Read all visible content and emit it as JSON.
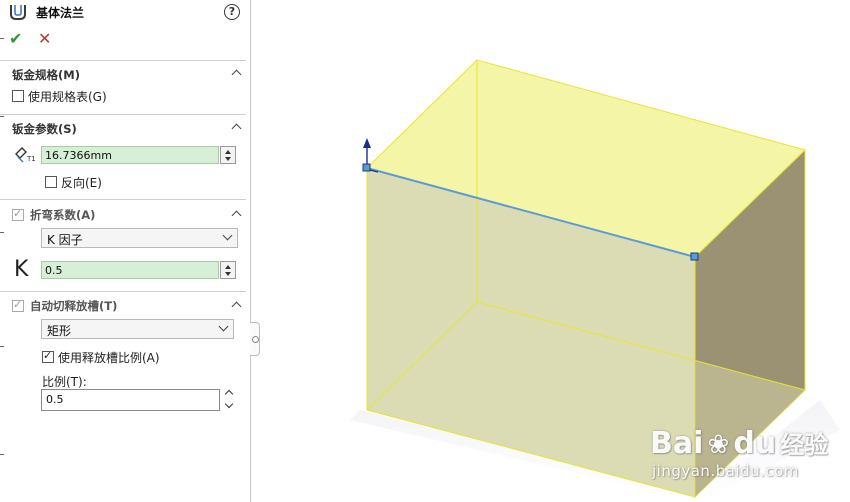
{
  "panel": {
    "title": "基体法兰",
    "help_icon": "help-circle-icon",
    "ok_icon": "checkmark-icon",
    "cancel_icon": "close-icon"
  },
  "sections": {
    "gauge": {
      "title": "钣金规格(M)",
      "use_gauge_table_label": "使用规格表(G)",
      "use_gauge_table_checked": false
    },
    "params": {
      "title": "钣金参数(S)",
      "thickness_value": "16.7366mm",
      "reverse_label": "反向(E)",
      "reverse_checked": false
    },
    "bend_allowance": {
      "title": "折弯系数(A)",
      "type_value": "K 因子",
      "k_value": "0.5",
      "enabled": true
    },
    "auto_relief": {
      "title": "自动切释放槽(T)",
      "type_value": "矩形",
      "use_ratio_label": "使用释放槽比例(A)",
      "use_ratio_checked": true,
      "ratio_label": "比例(T):",
      "ratio_value": "0.5"
    }
  },
  "watermark": {
    "brand": "Bai",
    "brand_suffix": "du",
    "cn": "经验",
    "url": "jingyan.baidu.com"
  },
  "colors": {
    "face_fill": "#f5f5a8",
    "edge": "#e6e62e",
    "selected_edge": "#5b9bd5",
    "side_dark": "#9b9274",
    "accent_green": "#d6efd6"
  }
}
